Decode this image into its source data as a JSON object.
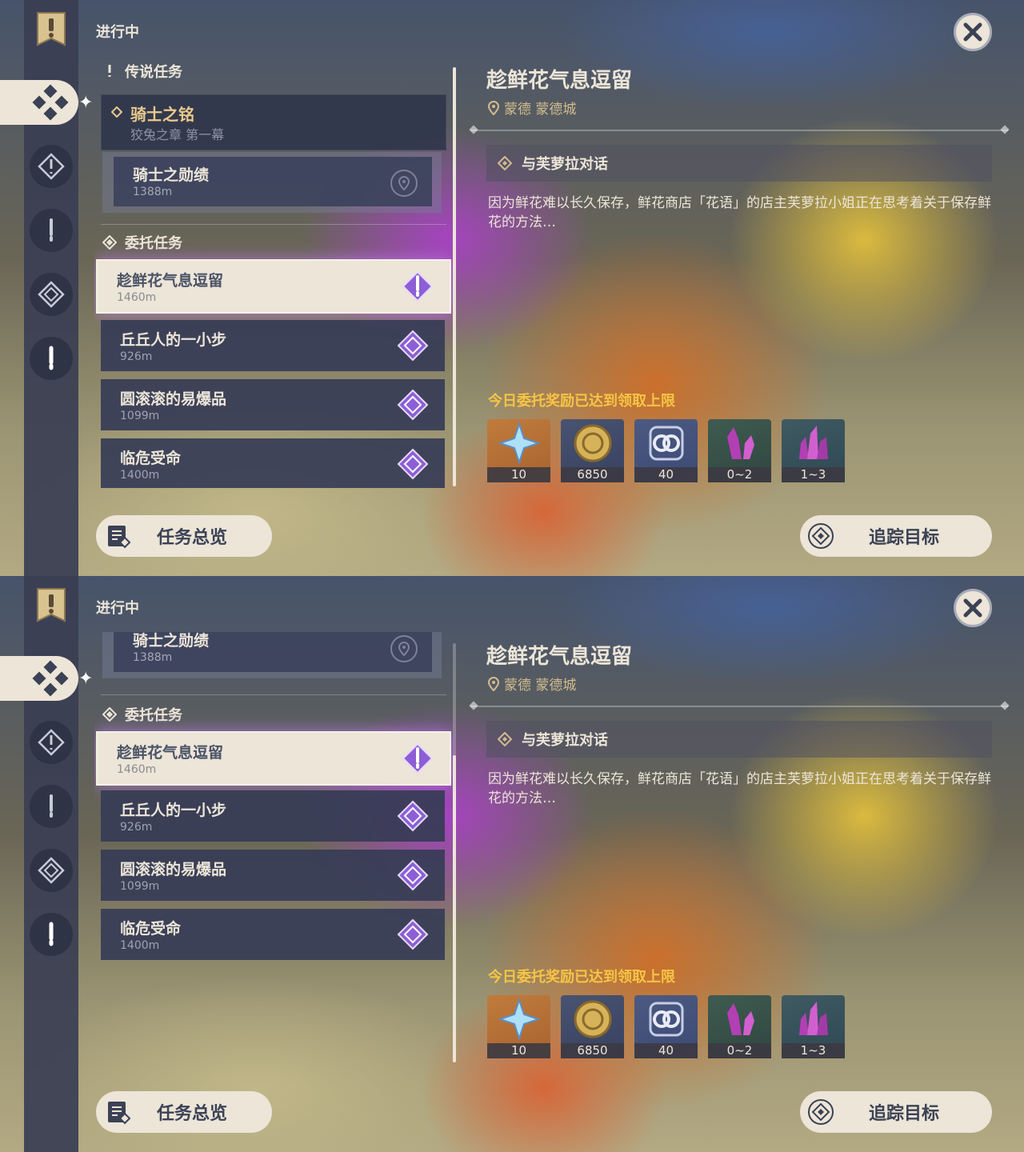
{
  "header": {
    "title": "进行中"
  },
  "sections": {
    "legend": "传说任务",
    "commission": "委托任务"
  },
  "legend_quest": {
    "title": "骑士之铭",
    "subtitle": "狡兔之章 第一幕"
  },
  "sub_quest": {
    "title": "骑士之勋绩",
    "distance": "1388m"
  },
  "tasks": [
    {
      "title": "趁鲜花气息逗留",
      "distance": "1460m"
    },
    {
      "title": "丘丘人的一小步",
      "distance": "926m"
    },
    {
      "title": "圆滚滚的易爆品",
      "distance": "1099m"
    },
    {
      "title": "临危受命",
      "distance": "1400m"
    }
  ],
  "detail": {
    "title": "趁鲜花气息逗留",
    "location": "蒙德 蒙德城",
    "objective": "与芙萝拉对话",
    "description": "因为鲜花难以长久保存，鲜花商店「花语」的店主芙萝拉小姐正在思考着关于保存鲜花的方法…",
    "limit_notice": "今日委托奖励已达到领取上限",
    "rewards": [
      {
        "icon": "primogem-icon",
        "count": "10"
      },
      {
        "icon": "mora-icon",
        "count": "6850"
      },
      {
        "icon": "companionship-exp-icon",
        "count": "40"
      },
      {
        "icon": "crystal-icon",
        "count": "0~2"
      },
      {
        "icon": "crystal-cluster-icon",
        "count": "1~3"
      }
    ]
  },
  "buttons": {
    "overview": "任务总览",
    "track": "追踪目标"
  },
  "colors": {
    "gold": "#d3bc8e",
    "limit": "#f6c544",
    "cream": "#ece5d8",
    "purple": "#b265e8"
  },
  "panels": [
    {
      "list_scroll": "top"
    },
    {
      "list_scroll": "bottom"
    }
  ]
}
